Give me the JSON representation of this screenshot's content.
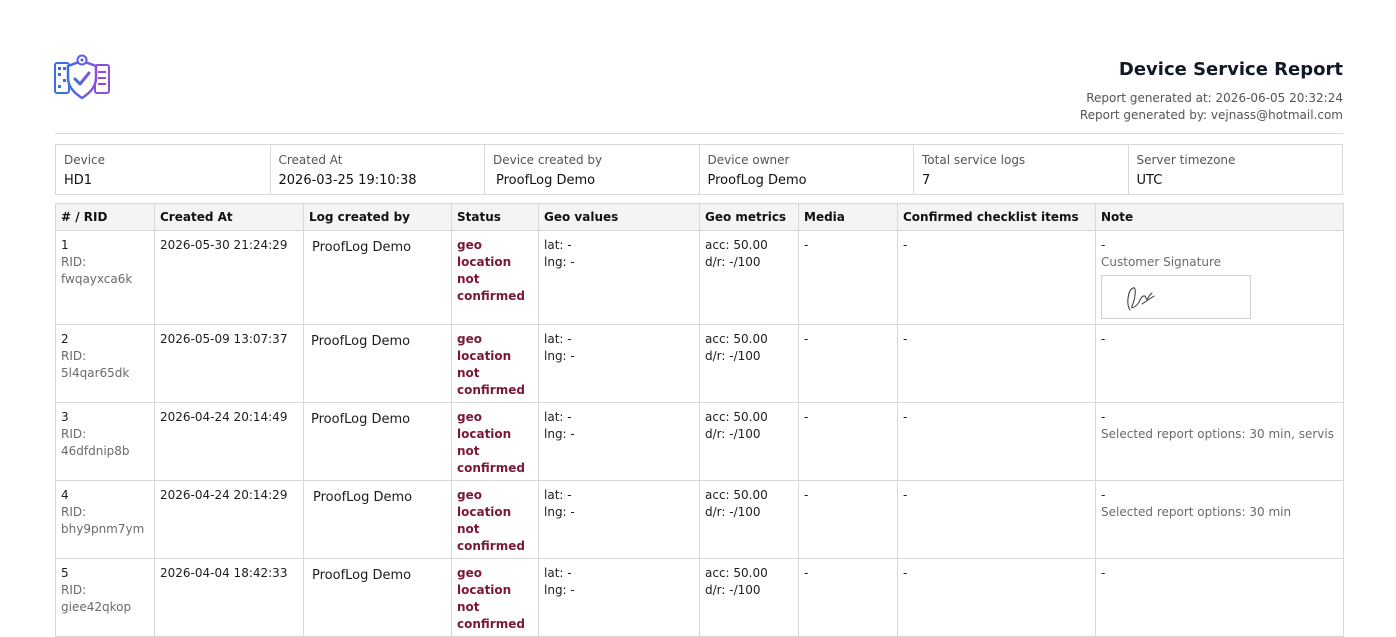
{
  "report": {
    "title": "Device Service Report",
    "generated_at": "Report generated at: 2026-06-05 20:32:24",
    "generated_by": "Report generated by: vejnass@hotmail.com"
  },
  "summary": [
    {
      "label": "Device",
      "value": "HD1"
    },
    {
      "label": "Created At",
      "value": "2026-03-25 19:10:38"
    },
    {
      "label": "Device created by",
      "value": "ProofLog Demo"
    },
    {
      "label": "Device owner",
      "value": "ProofLog Demo"
    },
    {
      "label": "Total service logs",
      "value": "7"
    },
    {
      "label": "Server timezone",
      "value": "UTC"
    }
  ],
  "table": {
    "headers": [
      "# / RID",
      "Created At",
      "Log created by",
      "Status",
      "Geo values",
      "Geo metrics",
      "Media",
      "Confirmed checklist items",
      "Note"
    ],
    "rows": [
      {
        "num": "1",
        "rid_label": "RID:",
        "rid": "fwqayxca6k",
        "created": "2026-05-30 21:24:29",
        "author": "ProofLog Demo",
        "status": [
          "geo",
          "location",
          "not",
          "confirmed"
        ],
        "lat": "lat: -",
        "lng": "lng: -",
        "acc": "acc: 50.00",
        "dr": "d/r: -/100",
        "media": "-",
        "checklist": "-",
        "note": "-",
        "note_sub": "Customer Signature"
      },
      {
        "num": "2",
        "rid_label": "RID:",
        "rid": "5l4qar65dk",
        "created": "2026-05-09 13:07:37",
        "author": "ProofLog Demo",
        "status": [
          "geo",
          "location",
          "not",
          "confirmed"
        ],
        "lat": "lat: -",
        "lng": "lng: -",
        "acc": "acc: 50.00",
        "dr": "d/r: -/100",
        "media": "-",
        "checklist": "-",
        "note": "-",
        "note_sub": ""
      },
      {
        "num": "3",
        "rid_label": "RID:",
        "rid": "46dfdnip8b",
        "created": "2026-04-24 20:14:49",
        "author": "ProofLog Demo",
        "status": [
          "geo",
          "location",
          "not",
          "confirmed"
        ],
        "lat": "lat: -",
        "lng": "lng: -",
        "acc": "acc: 50.00",
        "dr": "d/r: -/100",
        "media": "-",
        "checklist": "-",
        "note": "-",
        "note_sub": "Selected report options: 30 min, servis"
      },
      {
        "num": "4",
        "rid_label": "RID:",
        "rid": "bhy9pnm7ym",
        "created": "2026-04-24 20:14:29",
        "author": "ProofLog Demo",
        "status": [
          "geo",
          "location",
          "not",
          "confirmed"
        ],
        "lat": "lat: -",
        "lng": "lng: -",
        "acc": "acc: 50.00",
        "dr": "d/r: -/100",
        "media": "-",
        "checklist": "-",
        "note": "-",
        "note_sub": "Selected report options: 30 min"
      },
      {
        "num": "5",
        "rid_label": "RID:",
        "rid": "giee42qkop",
        "created": "2026-04-04 18:42:33",
        "author": "ProofLog Demo",
        "status": [
          "geo",
          "location",
          "not",
          "confirmed"
        ],
        "lat": "lat: -",
        "lng": "lng: -",
        "acc": "acc: 50.00",
        "dr": "d/r: -/100",
        "media": "-",
        "checklist": "-",
        "note": "-",
        "note_sub": ""
      }
    ]
  },
  "icons": {
    "logo": "shield-check-location-icon",
    "signature": "handwritten-signature-image"
  },
  "colors": {
    "status_text": "#7a1836",
    "logo_blue": "#3b6fe0",
    "logo_purple": "#8a4fe0",
    "header_bg": "#f3f4f6"
  }
}
